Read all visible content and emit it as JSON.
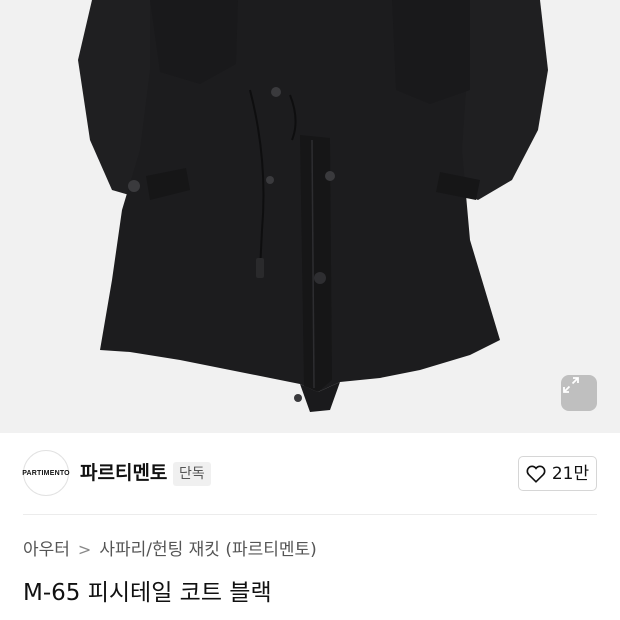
{
  "product_image": {
    "alt": ""
  },
  "expand_button": {
    "icon": "expand-icon"
  },
  "brand": {
    "logo_text": "PARTIMENTO",
    "name": "파르티멘토",
    "badge": "단독"
  },
  "like": {
    "icon": "heart-icon",
    "count": "21만"
  },
  "breadcrumb": {
    "category": "아우터",
    "separator": ">",
    "subcategory": "사파리/헌팅 재킷 (파르티멘토)"
  },
  "product": {
    "title": "M-65 피시테일 코트 블랙"
  },
  "colors": {
    "background": "#ffffff",
    "hero_bg": "#f1f1f1",
    "coat": "#1c1c1e",
    "badge_bg": "#f0f0f0"
  }
}
